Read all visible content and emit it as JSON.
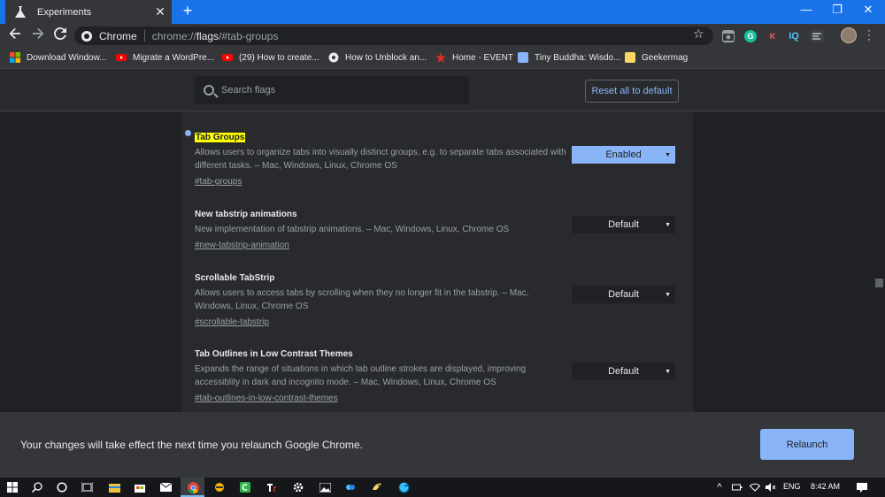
{
  "browser": {
    "tab_title": "Experiments",
    "tab_close": "✕",
    "new_tab": "+",
    "window_controls": {
      "minimize": "—",
      "restore": "❐",
      "close": "✕"
    },
    "omnibox": {
      "site_name": "Chrome",
      "url_scheme": "chrome://",
      "url_host": "flags",
      "url_rest": "/#tab-groups"
    },
    "extensions": [
      "camera-icon",
      "grammarly-icon",
      "k-icon",
      "iq-icon",
      "ext-icon"
    ],
    "ext_labels": {
      "k": "K",
      "iq": "IQ"
    }
  },
  "bookmarks": [
    {
      "label": "Download Window...",
      "icon": "windows-icon",
      "color": "#f25022"
    },
    {
      "label": "Migrate a WordPre...",
      "icon": "youtube-icon",
      "color": "#ff0000"
    },
    {
      "label": "(29) How to create...",
      "icon": "youtube-icon",
      "color": "#ff0000"
    },
    {
      "label": "How to Unblock an...",
      "icon": "globe-icon",
      "color": "#e8eaed"
    },
    {
      "label": "Home - EVENT",
      "icon": "event-icon",
      "color": "#d93025"
    },
    {
      "label": "Tiny Buddha: Wisdo...",
      "icon": "tinybuddha-icon",
      "color": "#8ab4f8"
    },
    {
      "label": "Geekermag",
      "icon": "folder-icon",
      "color": "#fdd663"
    }
  ],
  "flags_page": {
    "search_placeholder": "Search flags",
    "reset_label": "Reset all to default",
    "flags": [
      {
        "title": "Tab Groups",
        "description": "Allows users to organize tabs into visually distinct groups, e.g. to separate tabs associated with different tasks. – Mac, Windows, Linux, Chrome OS",
        "link": "#tab-groups",
        "state": "Enabled"
      },
      {
        "title": "New tabstrip animations",
        "description": "New implementation of tabstrip animations. – Mac, Windows, Linux, Chrome OS",
        "link": "#new-tabstrip-animation",
        "state": "Default"
      },
      {
        "title": "Scrollable TabStrip",
        "description": "Allows users to access tabs by scrolling when they no longer fit in the tabstrip. – Mac, Windows, Linux, Chrome OS",
        "link": "#scrollable-tabstrip",
        "state": "Default"
      },
      {
        "title": "Tab Outlines in Low Contrast Themes",
        "description": "Expands the range of situations in which tab outline strokes are displayed, improving accessiblity in dark and incognito mode. – Mac, Windows, Linux, Chrome OS",
        "link": "#tab-outlines-in-low-contrast-themes",
        "state": "Default"
      }
    ],
    "dropdown_arrow": "▼"
  },
  "relaunch": {
    "message": "Your changes will take effect the next time you relaunch Google Chrome.",
    "button": "Relaunch"
  },
  "taskbar": {
    "language": "ENG",
    "time": "8:42 AM"
  },
  "colors": {
    "accent": "#1a73e8",
    "link_blue": "#8ab4f8",
    "highlight": "#ffff00"
  }
}
